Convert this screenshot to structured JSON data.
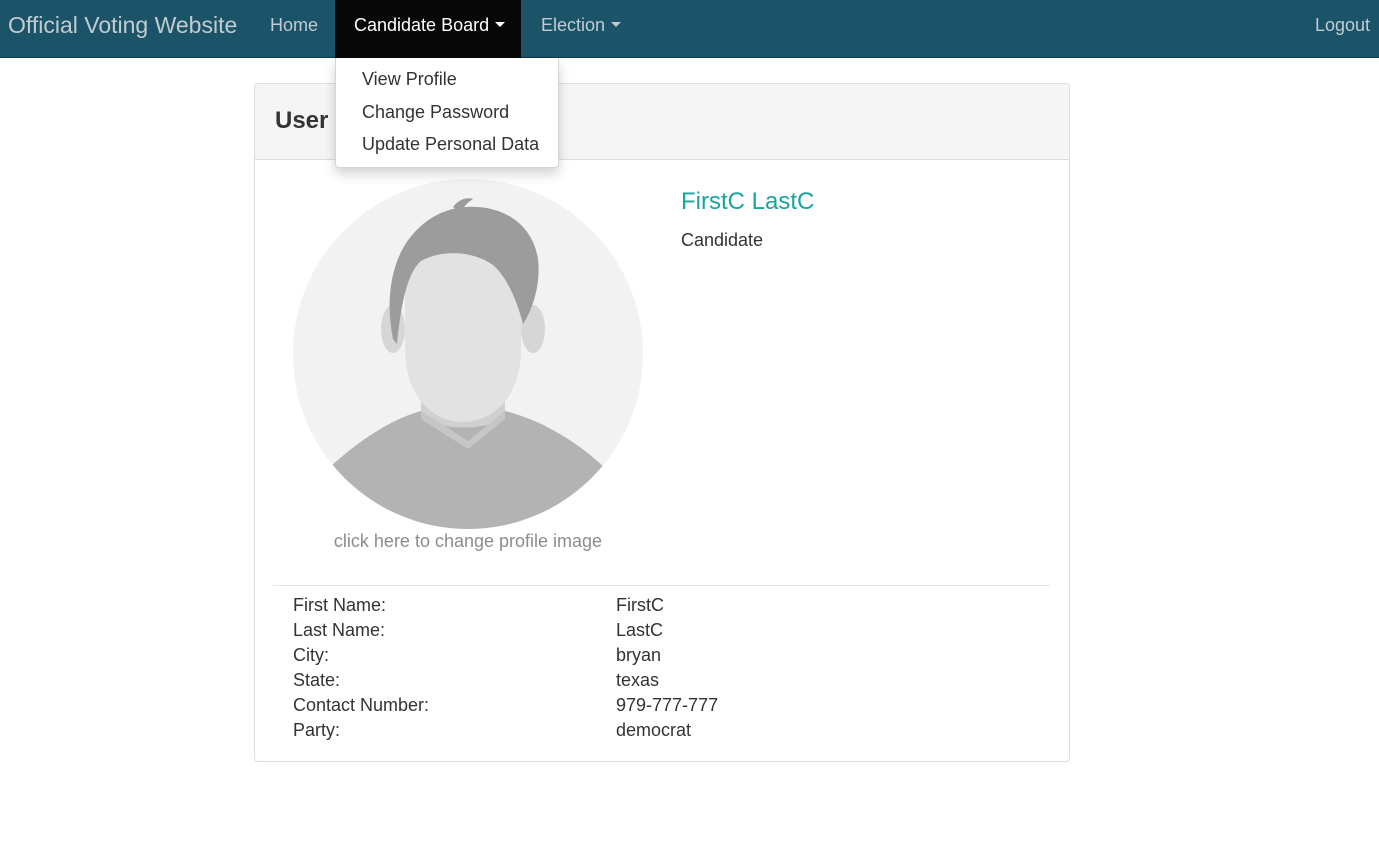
{
  "navbar": {
    "brand": "Official Voting Website",
    "home": "Home",
    "candidate_board": "Candidate Board",
    "election": "Election",
    "logout": "Logout"
  },
  "dropdown": {
    "items": [
      "View Profile",
      "Change Password",
      "Update Personal Data"
    ]
  },
  "panel": {
    "title": "User Profile",
    "change_image_text": "click here to change profile image",
    "name": "FirstC LastC",
    "role": "Candidate",
    "details": [
      {
        "label": "First Name:",
        "value": "FirstC"
      },
      {
        "label": "Last Name:",
        "value": "LastC"
      },
      {
        "label": "City:",
        "value": "bryan"
      },
      {
        "label": "State:",
        "value": "texas"
      },
      {
        "label": "Contact Number:",
        "value": "979-777-777"
      },
      {
        "label": "Party:",
        "value": "democrat"
      }
    ]
  },
  "colors": {
    "navbar_bg": "#1b5368",
    "active_nav_bg": "#080808",
    "name_accent": "#1aa3a3"
  },
  "icons": {
    "avatar": "default-user-avatar-icon",
    "dropdown_caret": "caret-down-icon"
  }
}
